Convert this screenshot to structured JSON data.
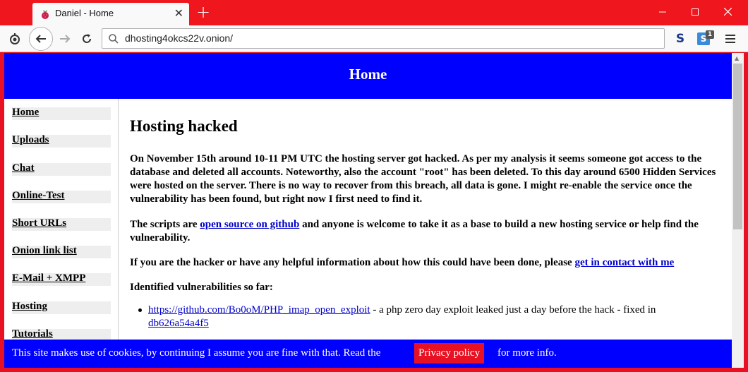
{
  "browser": {
    "tab_title": "Daniel - Home",
    "url": "dhosting4okcs22v.onion/",
    "extension_badge": "1",
    "window_controls": [
      "minimize-icon",
      "maximize-icon",
      "close-icon"
    ]
  },
  "page": {
    "header_title": "Home",
    "sidebar": [
      {
        "label": "Home"
      },
      {
        "label": "Uploads"
      },
      {
        "label": "Chat"
      },
      {
        "label": "Online-Test"
      },
      {
        "label": "Short URLs"
      },
      {
        "label": "Onion link list"
      },
      {
        "label": "E-Mail + XMPP"
      },
      {
        "label": "Hosting"
      },
      {
        "label": "Tutorials"
      }
    ],
    "heading": "Hosting hacked",
    "para1": "On November 15th around 10-11 PM UTC the hosting server got hacked. As per my analysis it seems someone got access to the database and deleted all accounts. Noteworthy, also the account \"root\" has been deleted. To this day around 6500 Hidden Services were hosted on the server. There is no way to recover from this breach, all data is gone. I might re-enable the service once the vulnerability has been found, but right now I first need to find it.",
    "para2_before": "The scripts are ",
    "para2_link": "open source on github",
    "para2_after": " and anyone is welcome to take it as a base to build a new hosting service or help find the vulnerability.",
    "para3_before": "If you are the hacker or have any helpful information about how this could have been done, please ",
    "para3_link": "get in contact with me",
    "vuln_heading": "Identified vulnerabilities so far:",
    "vuln_link": "https://github.com/Bo0oM/PHP_imap_open_exploit",
    "vuln_text": " - a php zero day exploit leaked just a day before the hack - fixed in ",
    "vuln_commit": "db626a54a4f5",
    "cookie_text": "This site makes use of cookies, by continuing I assume you are fine with that. Read the",
    "cookie_button": "Privacy policy",
    "cookie_after": "for more info."
  },
  "colors": {
    "browser_accent": "#e81123",
    "header_bg": "#0000ff",
    "link": "#0000cc"
  }
}
